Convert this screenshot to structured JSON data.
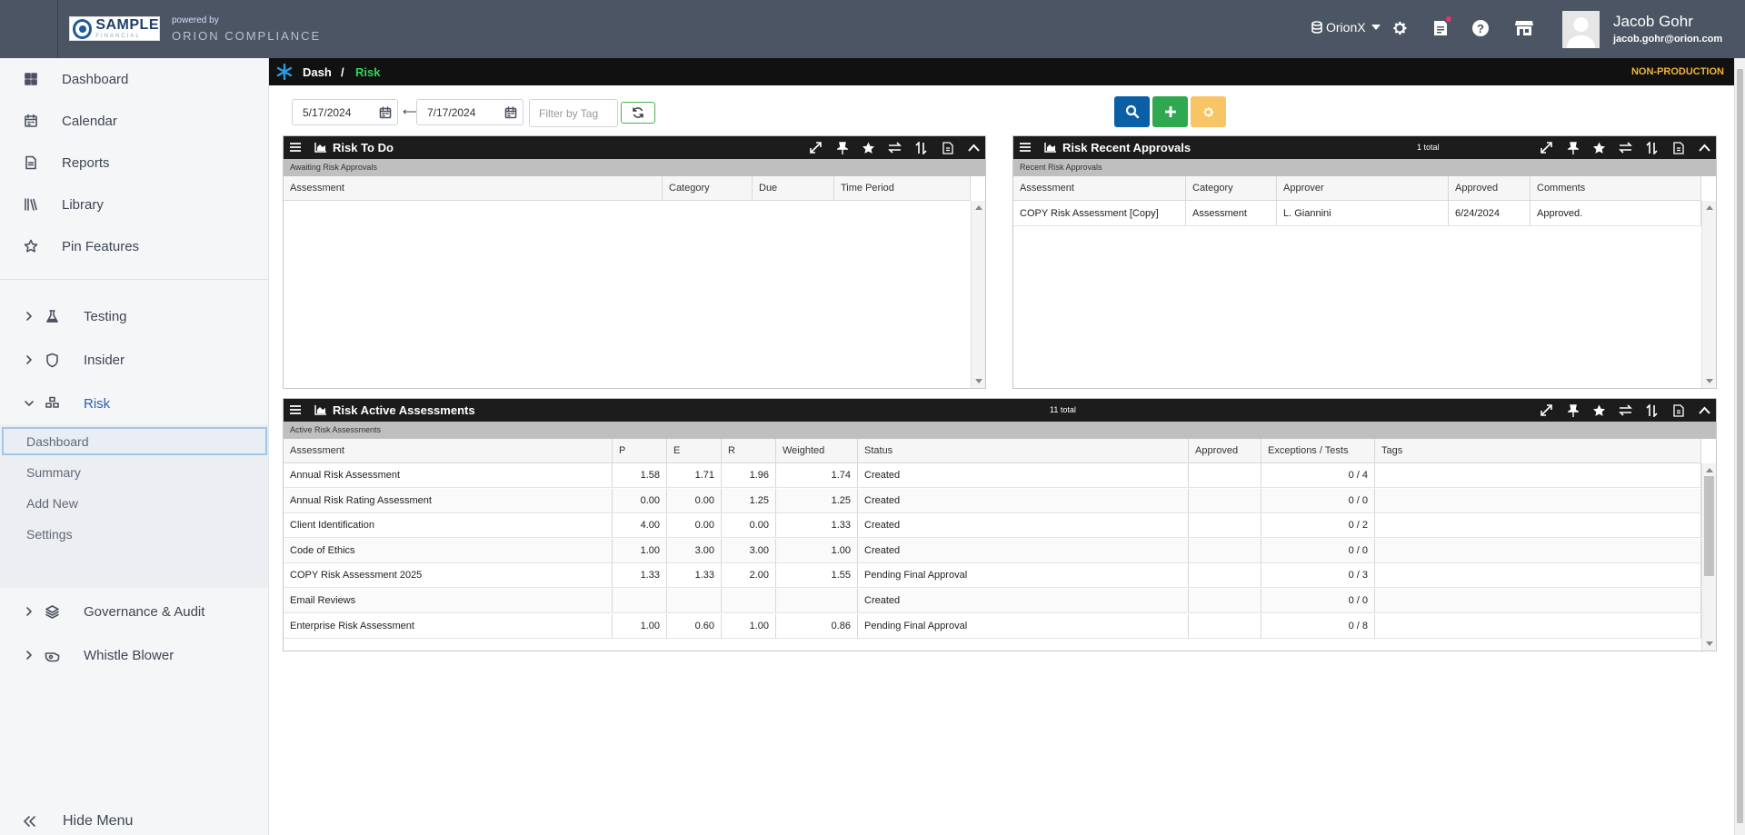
{
  "header": {
    "logo_name": "SAMPLE",
    "logo_sub": "FINANCIAL",
    "powered_by": "powered by",
    "product": "ORION COMPLIANCE",
    "db_name": "OrionX",
    "user_name": "Jacob Gohr",
    "user_email": "jacob.gohr@orion.com"
  },
  "sidebar": {
    "items": [
      {
        "label": "Dashboard",
        "icon": "dashboard-icon"
      },
      {
        "label": "Calendar",
        "icon": "calendar-icon"
      },
      {
        "label": "Reports",
        "icon": "document-icon"
      },
      {
        "label": "Library",
        "icon": "library-icon"
      },
      {
        "label": "Pin Features",
        "icon": "star-icon"
      }
    ],
    "groups": [
      {
        "label": "Testing",
        "icon": "flask-icon"
      },
      {
        "label": "Insider",
        "icon": "shield-icon"
      },
      {
        "label": "Risk",
        "icon": "cubes-icon"
      },
      {
        "label": "Governance & Audit",
        "icon": "layers-icon"
      },
      {
        "label": "Whistle Blower",
        "icon": "whistle-icon"
      }
    ],
    "risk_sub": [
      "Dashboard",
      "Summary",
      "Add New",
      "Settings"
    ],
    "hide_menu": "Hide Menu"
  },
  "breadcrumb": {
    "root": "Dash",
    "separator": "/",
    "current": "Risk",
    "environment": "NON-PRODUCTION"
  },
  "filters": {
    "start_date": "5/17/2024",
    "end_date": "7/17/2024",
    "tag_placeholder": "Filter by Tag",
    "range_symbol": "⟷"
  },
  "panels": {
    "todo": {
      "title": "Risk To Do",
      "subtitle": "Awaiting Risk Approvals",
      "columns": [
        "Assessment",
        "Category",
        "Due",
        "Time Period"
      ]
    },
    "approvals": {
      "title": "Risk Recent Approvals",
      "total": "1 total",
      "subtitle": "Recent Risk Approvals",
      "columns": [
        "Assessment",
        "Category",
        "Approver",
        "Approved",
        "Comments"
      ],
      "rows": [
        [
          "COPY Risk Assessment [Copy]",
          "Assessment",
          "L. Giannini",
          "6/24/2024",
          "Approved."
        ]
      ]
    },
    "active": {
      "title": "Risk Active Assessments",
      "total": "11 total",
      "subtitle": "Active Risk Assessments",
      "columns": [
        "Assessment",
        "P",
        "E",
        "R",
        "Weighted",
        "Status",
        "Approved",
        "Exceptions / Tests",
        "Tags"
      ],
      "rows": [
        [
          "Annual Risk Assessment",
          "1.58",
          "1.71",
          "1.96",
          "1.74",
          "Created",
          "",
          "0 / 4",
          ""
        ],
        [
          "Annual Risk Rating Assessment",
          "0.00",
          "0.00",
          "1.25",
          "1.25",
          "Created",
          "",
          "0 / 0",
          ""
        ],
        [
          "Client Identification",
          "4.00",
          "0.00",
          "0.00",
          "1.33",
          "Created",
          "",
          "0 / 2",
          ""
        ],
        [
          "Code of Ethics",
          "1.00",
          "3.00",
          "3.00",
          "1.00",
          "Created",
          "",
          "0 / 0",
          ""
        ],
        [
          "COPY Risk Assessment 2025",
          "1.33",
          "1.33",
          "2.00",
          "1.55",
          "Pending Final Approval",
          "",
          "0 / 3",
          ""
        ],
        [
          "Email Reviews",
          "",
          "",
          "",
          "",
          "Created",
          "",
          "0 / 0",
          ""
        ],
        [
          "Enterprise Risk Assessment",
          "1.00",
          "0.60",
          "1.00",
          "0.86",
          "Pending Final Approval",
          "",
          "0 / 8",
          ""
        ]
      ]
    }
  },
  "colors": {
    "header_bg": "#4c5563",
    "accent_green": "#35d35a",
    "search_btn": "#0b5fa5",
    "add_btn": "#2fa84f",
    "settings_btn": "#f7c566",
    "env_badge": "#f0b43a"
  }
}
